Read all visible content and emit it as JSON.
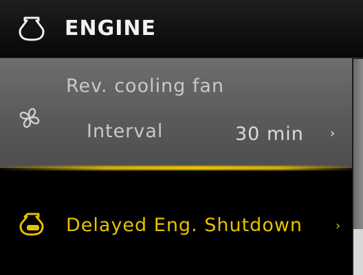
{
  "header": {
    "title": "ENGINE",
    "icon": "engine-icon"
  },
  "menu": {
    "items": [
      {
        "title": "Rev. cooling fan",
        "icon": "fan-icon",
        "sub_label": "Interval",
        "value": "30 min",
        "chevron": "›",
        "selected": true
      },
      {
        "title": "Delayed Eng. Shutdown",
        "icon": "delayed-shutdown-icon",
        "chevron": "›",
        "selected": false
      }
    ]
  },
  "colors": {
    "accent_amber": "#e8c200",
    "selected_row": "#5f5f5f",
    "background": "#000000",
    "text_light": "#f2f2f2"
  }
}
